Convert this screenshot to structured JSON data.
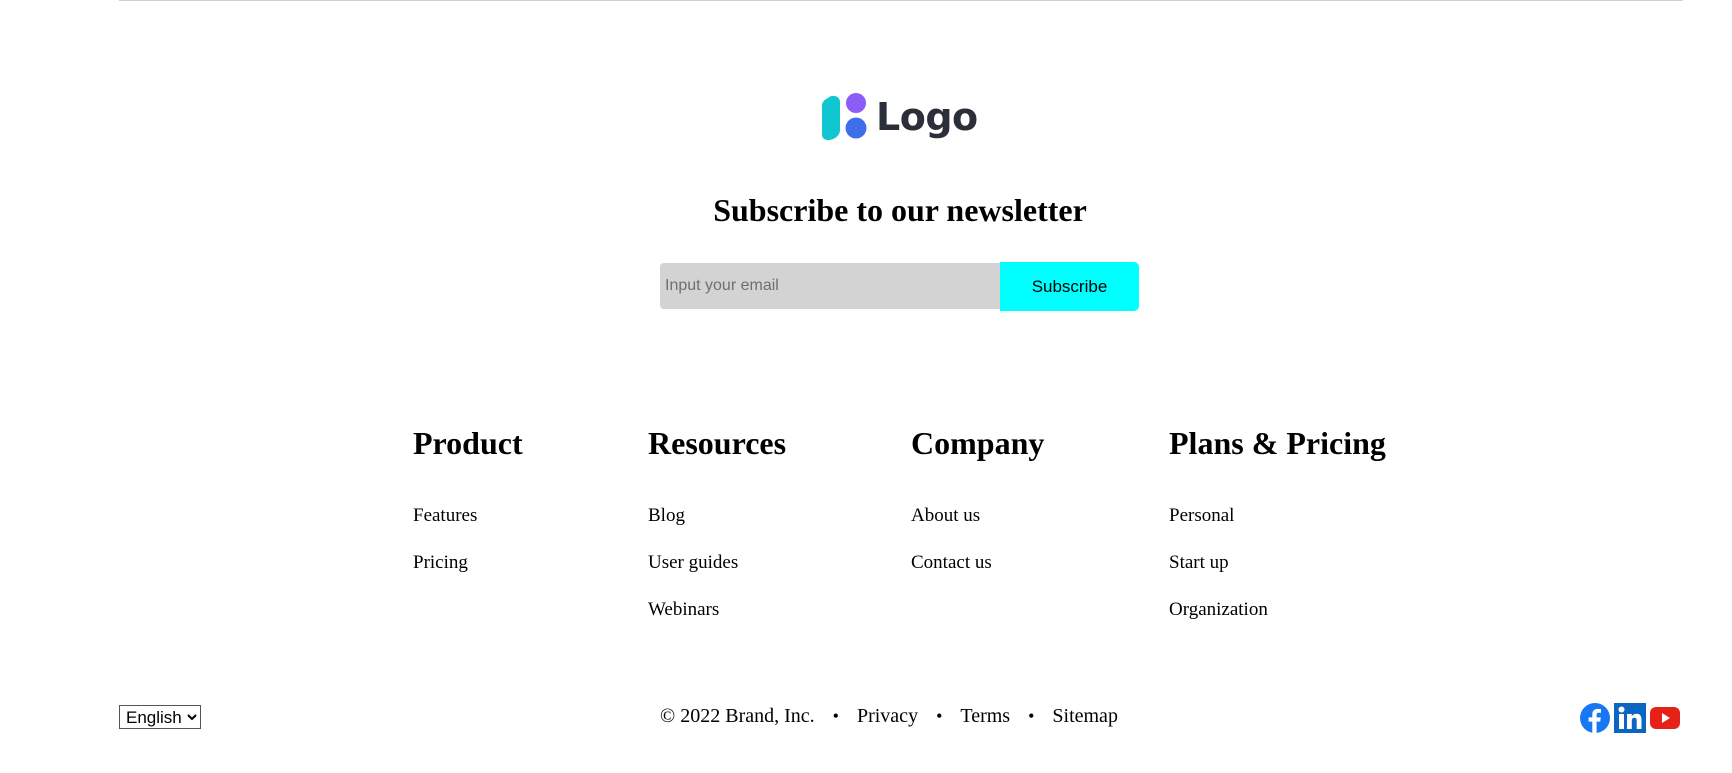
{
  "logo": {
    "text": "Logo"
  },
  "newsletter": {
    "title": "Subscribe to our newsletter",
    "email_placeholder": "Input your email",
    "subscribe_label": "Subscribe"
  },
  "columns": [
    {
      "heading": "Product",
      "links": [
        "Features",
        "Pricing"
      ]
    },
    {
      "heading": "Resources",
      "links": [
        "Blog",
        "User guides",
        "Webinars"
      ]
    },
    {
      "heading": "Company",
      "links": [
        "About us",
        "Contact us"
      ]
    },
    {
      "heading": "Plans & Pricing",
      "links": [
        "Personal",
        "Start up",
        "Organization"
      ]
    }
  ],
  "footer": {
    "language": "English",
    "copyright": "© 2022 Brand, Inc.",
    "links": [
      "Privacy",
      "Terms",
      "Sitemap"
    ]
  },
  "social": [
    "facebook-icon",
    "linkedin-icon",
    "youtube-icon"
  ],
  "colors": {
    "subscribe_button": "#00ffff",
    "input_background": "#d3d3d3",
    "facebook": "#1877f2",
    "linkedin": "#0a66c2",
    "youtube": "#e62117"
  }
}
